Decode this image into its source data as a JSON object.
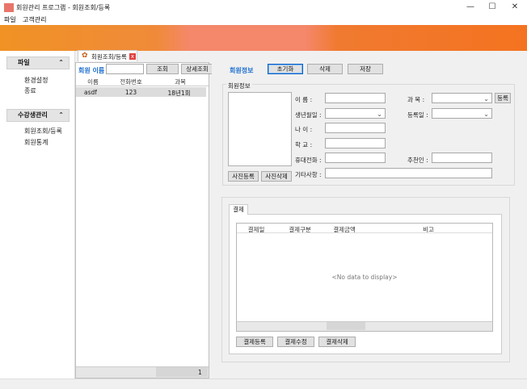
{
  "window": {
    "title": "회원관리 프로그램 - 회원조회/등록",
    "minimize_glyph": "—",
    "maximize_glyph": "☐",
    "close_glyph": "✕"
  },
  "menu": [
    "파일",
    "고객관리"
  ],
  "sidebar": {
    "groups": [
      {
        "title": "파일",
        "chevron": "⌃",
        "items": [
          "환경설정",
          "종료"
        ]
      },
      {
        "title": "수강생관리",
        "chevron": "⌃",
        "items": [
          "회원조회/등록",
          "회원통계"
        ]
      }
    ]
  },
  "tab": {
    "label": "회원조회/등록",
    "close": "x",
    "icon": "gear-icon"
  },
  "search": {
    "label": "회원 이름",
    "value": "",
    "search_button": "조회",
    "detail_button": "상세조회"
  },
  "member_grid": {
    "columns": [
      "이름",
      "전화번호",
      "과목"
    ],
    "rows": [
      [
        "asdf",
        "123",
        "18년1회"
      ]
    ],
    "footer_count": "1"
  },
  "toolbar": {
    "section_label": "회원정보",
    "reset": "초기화",
    "delete": "삭제",
    "save": "저장"
  },
  "member_info": {
    "group_title": "회원정보",
    "photo_register": "사진등록",
    "photo_delete": "사진삭제",
    "name_label": "이      름 :",
    "birth_label": "생년월일 :",
    "age_label": "나      이 :",
    "school_label": "학      교 :",
    "phone_label": "휴대전화 :",
    "etc_label": "기타사항 :",
    "subject_label": "과      목 :",
    "regdate_label": "등록일 :",
    "referrer_label": "추천인 :",
    "subject_register": "등록"
  },
  "payment": {
    "tab_label": "결제",
    "columns": [
      "결제일",
      "결제구분",
      "결제금액",
      "비고"
    ],
    "empty_text": "<No data to display>",
    "register": "결제등록",
    "modify": "결제수정",
    "delete": "결제삭제"
  },
  "colors": {
    "accent_blue": "#1e6fd0",
    "banner_orange": "#f47320",
    "banner_pink": "#f5876a"
  }
}
